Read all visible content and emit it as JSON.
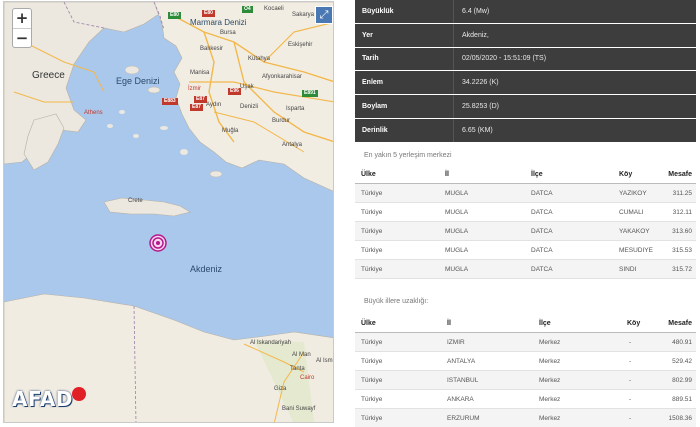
{
  "map": {
    "zoom_in": "+",
    "zoom_out": "−",
    "fullscreen": "⤢",
    "labels": {
      "greece": "Greece",
      "ege_denizi": "Ege Denizi",
      "marmara": "Marmara Denizi",
      "akdeniz": "Akdeniz",
      "athens": "Athens",
      "bursa": "Bursa",
      "balikesir": "Balıkesir",
      "izmir": "İzmir",
      "manisa": "Manisa",
      "afyon": "Afyonkarahisar",
      "aydin": "Aydın",
      "mugla": "Muğla",
      "denizli": "Denizli",
      "burdur": "Burdur",
      "antalya": "Antalya",
      "isparta": "Isparta",
      "kutahya": "Kütahya",
      "eskisehir": "Eskişehir",
      "usak": "Uşak",
      "kocaeli": "Kocaeli",
      "sakarya": "Sakarya",
      "crete": "Crete",
      "alexandria": "Al Iskandariyah",
      "tanta": "Tanta",
      "cairo": "Cairo",
      "al_ism": "Al Ism",
      "al_man": "Al Man",
      "giza": "Giza",
      "bani_suwayf": "Bani Suwayf"
    },
    "logo_text": "AFAD"
  },
  "details": [
    {
      "key": "Büyüklük",
      "value": "6.4 (Mw)"
    },
    {
      "key": "Yer",
      "value": "Akdeniz,"
    },
    {
      "key": "Tarih",
      "value": "02/05/2020 - 15:51:09 (TS)"
    },
    {
      "key": "Enlem",
      "value": "34.2226 (K)"
    },
    {
      "key": "Boylam",
      "value": "25.8253 (D)"
    },
    {
      "key": "Derinlik",
      "value": "6.65 (KM)"
    }
  ],
  "nearest": {
    "title": "En yakın 5 yerleşim merkezi",
    "headers": [
      "Ülke",
      "İl",
      "İlçe",
      "Köy",
      "Mesafe"
    ],
    "rows": [
      [
        "Türkiye",
        "MUGLA",
        "DATCA",
        "YAZIKOY",
        "311.25"
      ],
      [
        "Türkiye",
        "MUGLA",
        "DATCA",
        "CUMALI",
        "312.11"
      ],
      [
        "Türkiye",
        "MUGLA",
        "DATCA",
        "YAKAKOY",
        "313.60"
      ],
      [
        "Türkiye",
        "MUGLA",
        "DATCA",
        "MESUDIYE",
        "315.53"
      ],
      [
        "Türkiye",
        "MUGLA",
        "DATCA",
        "SINDI",
        "315.72"
      ]
    ]
  },
  "cities": {
    "title": "Büyük illere uzaklığı:",
    "headers": [
      "Ülke",
      "İl",
      "İlçe",
      "Köy",
      "Mesafe"
    ],
    "rows": [
      [
        "Türkiye",
        "IZMIR",
        "Merkez",
        "-",
        "480.91"
      ],
      [
        "Türkiye",
        "ANTALYA",
        "Merkez",
        "-",
        "529.42"
      ],
      [
        "Türkiye",
        "ISTANBUL",
        "Merkez",
        "-",
        "802.99"
      ],
      [
        "Türkiye",
        "ANKARA",
        "Merkez",
        "-",
        "889.51"
      ],
      [
        "Türkiye",
        "ERZURUM",
        "Merkez",
        "-",
        "1508.36"
      ]
    ]
  }
}
